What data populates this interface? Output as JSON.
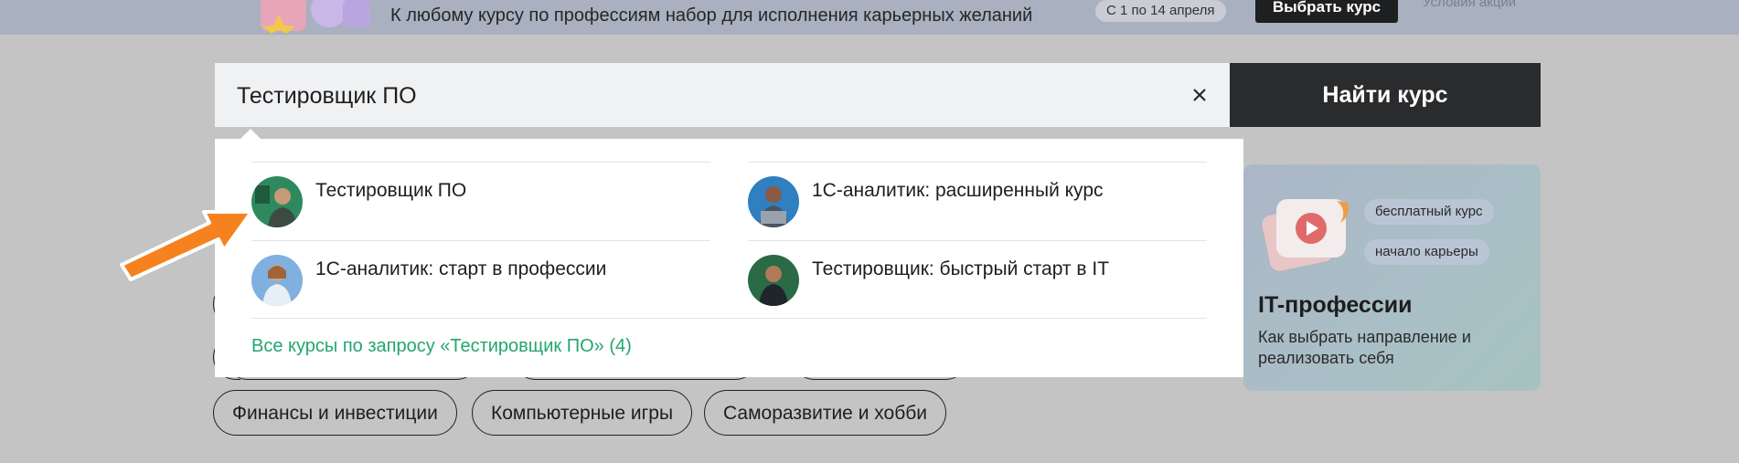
{
  "promo": {
    "text": "К любому курсу по профессиям набор для исполнения карьерных желаний",
    "date_badge": "С 1 по 14 апреля",
    "button_label": "Выбрать курс",
    "terms_link": "Условия акции"
  },
  "search": {
    "value": "Тестировщик ПО",
    "clear_icon": "close-icon",
    "button_label": "Найти курс"
  },
  "results": {
    "items": [
      {
        "title": "Тестировщик ПО",
        "avatar_color": "#2e8a5e"
      },
      {
        "title": "1С-аналитик: расширенный курс",
        "avatar_color": "#2f7fc1"
      },
      {
        "title": "1С-аналитик: старт в профессии",
        "avatar_color": "#7fb0e0"
      },
      {
        "title": "Тестировщик: быстрый старт в IT",
        "avatar_color": "#2a6a45"
      }
    ],
    "all_link": "Все курсы по запросу «Тестировщик ПО» (4)"
  },
  "tags": [
    "Финансы и инвестиции",
    "Компьютерные игры",
    "Саморазвитие и хобби"
  ],
  "card": {
    "pills": [
      "бесплатный курс",
      "начало карьеры"
    ],
    "title": "IT-профессии",
    "subtitle": "Как выбрать направление и реализовать себя"
  },
  "colors": {
    "overlay": "#c4c4c4",
    "link_green": "#24a56f",
    "dark_button": "#2a2b2d",
    "annotation_arrow": "#f5821f"
  }
}
